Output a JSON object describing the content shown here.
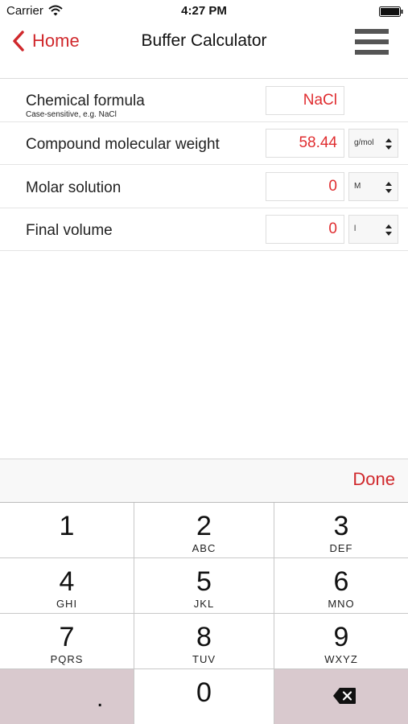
{
  "status_bar": {
    "carrier": "Carrier",
    "time": "4:27 PM"
  },
  "nav": {
    "back_label": "Home",
    "title": "Buffer Calculator",
    "accent_color": "#d0282c"
  },
  "form": {
    "rows": [
      {
        "label": "Chemical formula",
        "hint": "Case-sensitive, e.g. NaCl",
        "value": "NaCl",
        "unit": ""
      },
      {
        "label": "Compound molecular weight",
        "hint": "",
        "value": "58.44",
        "unit": "g/mol"
      },
      {
        "label": "Molar solution",
        "hint": "",
        "value": "0",
        "unit": "M"
      },
      {
        "label": "Final volume",
        "hint": "",
        "value": "0",
        "unit": "l"
      }
    ]
  },
  "accessory": {
    "done_label": "Done"
  },
  "keypad": {
    "keys": [
      {
        "digit": "1",
        "letters": ""
      },
      {
        "digit": "2",
        "letters": "ABC"
      },
      {
        "digit": "3",
        "letters": "DEF"
      },
      {
        "digit": "4",
        "letters": "GHI"
      },
      {
        "digit": "5",
        "letters": "JKL"
      },
      {
        "digit": "6",
        "letters": "MNO"
      },
      {
        "digit": "7",
        "letters": "PQRS"
      },
      {
        "digit": "8",
        "letters": "TUV"
      },
      {
        "digit": "9",
        "letters": "WXYZ"
      },
      {
        "digit": ".",
        "letters": ""
      },
      {
        "digit": "0",
        "letters": ""
      }
    ]
  },
  "icons": {
    "wifi": "wifi-icon",
    "battery": "battery-icon",
    "back": "chevron-left-icon",
    "menu": "hamburger-menu-icon",
    "backspace": "backspace-icon"
  }
}
